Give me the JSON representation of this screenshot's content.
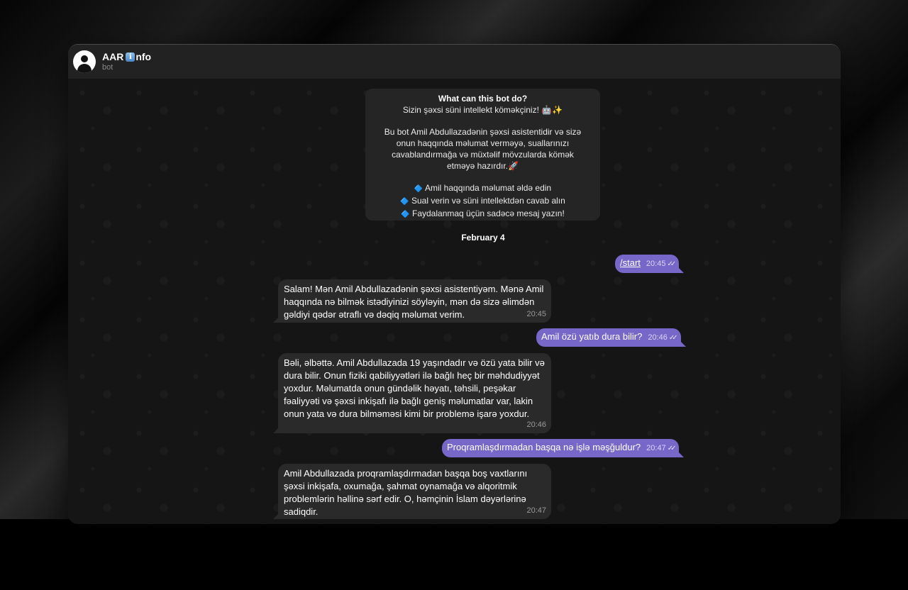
{
  "header": {
    "title_prefix": "AAR ",
    "title_badge": "i",
    "title_suffix": "nfo",
    "subtitle": "bot"
  },
  "bot_info": {
    "title": "What can this bot do?",
    "line1": "Sizin şəxsi süni intellekt köməkçiniz! 🤖✨",
    "para": [
      "Bu bot Amil Abdullazadənin şəxsi asistentidir və sizə",
      "onun haqqında məlumat verməyə, suallarınızı",
      "cavablandırmağa və müxtəlif mövzularda kömək",
      "etməyə hazırdır.🚀"
    ],
    "bullets": [
      "Amil haqqında məlumat əldə edin",
      "Sual verin və süni intellektdən cavab alın",
      "Faydalanmaq üçün sadəcə mesaj yazın!"
    ],
    "bullet_icon": "🔷"
  },
  "date_separator": "February 4",
  "messages": [
    {
      "text": "/start",
      "time": "20:45"
    },
    {
      "text": "Salam! Mən Amil Abdullazadənin şəxsi asistentiyəm. Mənə Amil haqqında nə bilmək istədiyinizi söyləyin, mən də sizə əlimdən gəldiyi qədər ətraflı və dəqiq məlumat verim.",
      "time": "20:45"
    },
    {
      "text": "Amil özü yatıb dura bilir?",
      "time": "20:46"
    },
    {
      "text": "Bəli, əlbəttə. Amil Abdullazada 19 yaşındadır və özü yata bilir və dura bilir. Onun fiziki qabiliyyətləri ilə bağlı heç bir məhdudiyyət yoxdur. Məlumatda onun gündəlik həyatı, təhsili, peşəkar fəaliyyəti və şəxsi inkişafı ilə bağlı geniş məlumatlar var, lakin onun yata və dura bilməməsi kimi bir problemə işarə yoxdur.",
      "time": "20:46"
    },
    {
      "text": "Proqramlaşdırmadan başqa nə işlə məşğuldur?",
      "time": "20:47"
    },
    {
      "text": "Amil Abdullazada proqramlaşdırmadan başqa boş vaxtlarını şəxsi inkişafa, oxumağa, şahmat oynamağa və alqoritmik problemlərin həllinə sərf edir. O, həmçinin İslam dəyərlərinə sadiqdir.",
      "time": "20:47"
    }
  ],
  "read_ticks": "✓✓"
}
